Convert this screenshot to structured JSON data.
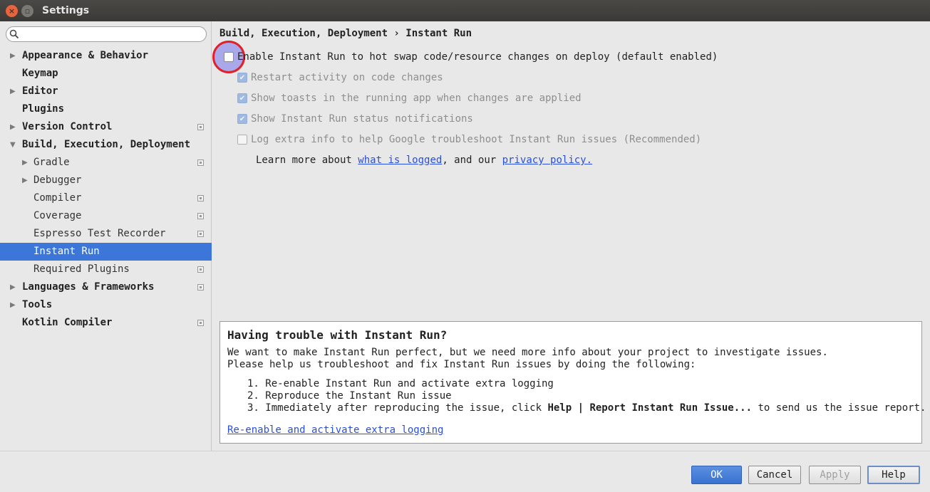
{
  "window": {
    "title": "Settings",
    "close_glyph": "×",
    "max_glyph": "▫"
  },
  "search": {
    "placeholder": ""
  },
  "sidebar": {
    "items": [
      {
        "label": "Appearance & Behavior",
        "level": 0,
        "arrow": "▶",
        "project_icon": false,
        "selected": false
      },
      {
        "label": "Keymap",
        "level": 0,
        "arrow": "",
        "project_icon": false,
        "selected": false
      },
      {
        "label": "Editor",
        "level": 0,
        "arrow": "▶",
        "project_icon": false,
        "selected": false
      },
      {
        "label": "Plugins",
        "level": 0,
        "arrow": "",
        "project_icon": false,
        "selected": false
      },
      {
        "label": "Version Control",
        "level": 0,
        "arrow": "▶",
        "project_icon": true,
        "selected": false
      },
      {
        "label": "Build, Execution, Deployment",
        "level": 0,
        "arrow": "▼",
        "project_icon": false,
        "selected": false
      },
      {
        "label": "Gradle",
        "level": 1,
        "arrow": "▶",
        "project_icon": true,
        "selected": false
      },
      {
        "label": "Debugger",
        "level": 1,
        "arrow": "▶",
        "project_icon": false,
        "selected": false
      },
      {
        "label": "Compiler",
        "level": 1,
        "arrow": "",
        "project_icon": true,
        "selected": false
      },
      {
        "label": "Coverage",
        "level": 1,
        "arrow": "",
        "project_icon": true,
        "selected": false
      },
      {
        "label": "Espresso Test Recorder",
        "level": 1,
        "arrow": "",
        "project_icon": true,
        "selected": false
      },
      {
        "label": "Instant Run",
        "level": 1,
        "arrow": "",
        "project_icon": false,
        "selected": true
      },
      {
        "label": "Required Plugins",
        "level": 1,
        "arrow": "",
        "project_icon": true,
        "selected": false
      },
      {
        "label": "Languages & Frameworks",
        "level": 0,
        "arrow": "▶",
        "project_icon": true,
        "selected": false
      },
      {
        "label": "Tools",
        "level": 0,
        "arrow": "▶",
        "project_icon": false,
        "selected": false
      },
      {
        "label": "Kotlin Compiler",
        "level": 0,
        "arrow": "",
        "project_icon": true,
        "selected": false
      }
    ]
  },
  "content": {
    "breadcrumb": "Build, Execution, Deployment › Instant Run",
    "options": {
      "enable": {
        "label": "Enable Instant Run to hot swap code/resource changes on deploy (default enabled)",
        "checked": false
      },
      "restart": {
        "label": "Restart activity on code changes",
        "checked": true
      },
      "toasts": {
        "label": "Show toasts in the running app when changes are applied",
        "checked": true
      },
      "status": {
        "label": "Show Instant Run status notifications",
        "checked": true
      },
      "log": {
        "label": "Log extra info to help Google troubleshoot Instant Run issues (Recommended)",
        "checked": false
      }
    },
    "learn_more": {
      "prefix": "Learn more about ",
      "link1": "what is logged",
      "middle": ", and our ",
      "link2": "privacy policy."
    },
    "check_glyph": "✔"
  },
  "trouble": {
    "heading": "Having trouble with Instant Run?",
    "line1": "We want to make Instant Run perfect, but we need more info about your project to investigate issues.",
    "line2": "Please help us troubleshoot and fix Instant Run issues by doing the following:",
    "step1": "1. Re-enable Instant Run and activate extra logging",
    "step2": "2. Reproduce the Instant Run issue",
    "step3_prefix": "3. Immediately after reproducing the issue, click ",
    "step3_bold": "Help | Report Instant Run Issue...",
    "step3_suffix": " to send us the issue report.",
    "link": "Re-enable and activate extra logging"
  },
  "buttons": {
    "ok": "OK",
    "cancel": "Cancel",
    "apply": "Apply",
    "help": "Help"
  },
  "colors": {
    "selection": "#3b76d8",
    "link": "#2a4fd8",
    "highlight_ring": "#e0202a"
  }
}
